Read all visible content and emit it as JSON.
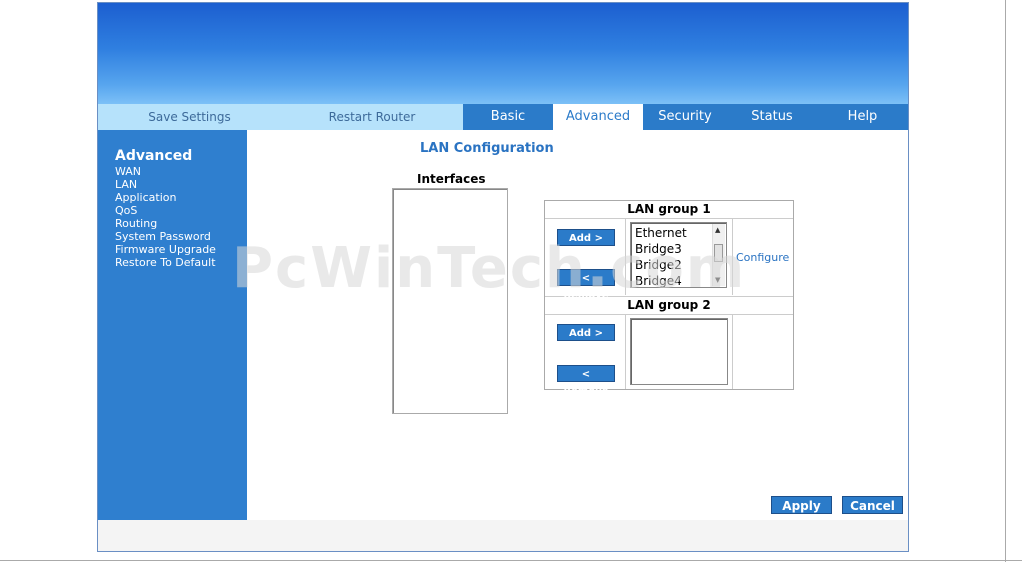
{
  "nav": {
    "utility_links": [
      "Save Settings",
      "Restart Router"
    ],
    "tabs": [
      {
        "label": "Basic",
        "active": false
      },
      {
        "label": "Advanced",
        "active": true
      },
      {
        "label": "Security",
        "active": false
      },
      {
        "label": "Status",
        "active": false
      },
      {
        "label": "Help",
        "active": false
      }
    ]
  },
  "sidebar": {
    "title": "Advanced",
    "items": [
      "WAN",
      "LAN",
      "Application",
      "QoS",
      "Routing",
      "System Password",
      "Firmware Upgrade",
      "Restore To Default"
    ]
  },
  "main": {
    "title": "LAN Configuration",
    "interfaces_label": "Interfaces",
    "group1": {
      "label": "LAN group 1",
      "add_label": "Add >",
      "remove_label": "< Remove",
      "members": [
        "Ethernet",
        "Bridge3",
        "Bridge2",
        "Bridge4"
      ],
      "configure_label": "Configure"
    },
    "group2": {
      "label": "LAN group 2",
      "add_label": "Add >",
      "remove_label": "< Remove",
      "members": []
    }
  },
  "actions": {
    "apply": "Apply",
    "cancel": "Cancel"
  },
  "watermark": "PcWinTech.com",
  "colors": {
    "tab_blue": "#2b7bc9",
    "light_tab": "#b6e2fb",
    "sidebar": "#2f7fcf",
    "link": "#2a73c2"
  }
}
